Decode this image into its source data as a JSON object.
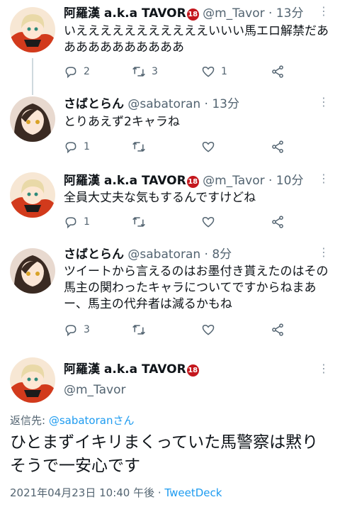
{
  "tweets": [
    {
      "name": "阿羅漢 a.k.a TAVOR",
      "badge": "18",
      "handle": "@m_Tavor",
      "time": "· 13分",
      "text": "いえええええええええええいいい馬エロ解禁だあああああああああああ",
      "replies": "2",
      "retweets": "3",
      "likes": "1"
    },
    {
      "name": "さばとらん",
      "handle": "@sabatoran",
      "time": "· 13分",
      "text": "とりあえず2キャラね",
      "replies": "1",
      "retweets": "",
      "likes": ""
    },
    {
      "name": "阿羅漢 a.k.a TAVOR",
      "badge": "18",
      "handle": "@m_Tavor",
      "time": "· 10分",
      "text": "全員大丈夫な気もするんですけどね",
      "replies": "1",
      "retweets": "",
      "likes": ""
    },
    {
      "name": "さばとらん",
      "handle": "@sabatoran",
      "time": "· 8分",
      "text": "ツイートから言えるのはお墨付き貰えたのはその馬主の関わったキャラについてですからねまあー、馬主の代弁者は減るかもね",
      "replies": "3",
      "retweets": "",
      "likes": ""
    }
  ],
  "focus": {
    "name": "阿羅漢 a.k.a TAVOR",
    "badge": "18",
    "handle": "@m_Tavor",
    "reply_prefix": "返信先: ",
    "reply_target": "@sabatoranさん",
    "text": "ひとまずイキリまくっていた馬警察は黙りそうで一安心です",
    "timestamp": "2021年04月23日 10:40 午後 · ",
    "source": "TweetDeck"
  },
  "icons": {
    "reply": "reply-icon",
    "retweet": "retweet-icon",
    "like": "heart-icon",
    "share": "share-icon",
    "more": "more-dots-icon"
  },
  "colors": {
    "link": "#1d9bf0",
    "muted": "#536471",
    "badge": "#c4171d"
  }
}
